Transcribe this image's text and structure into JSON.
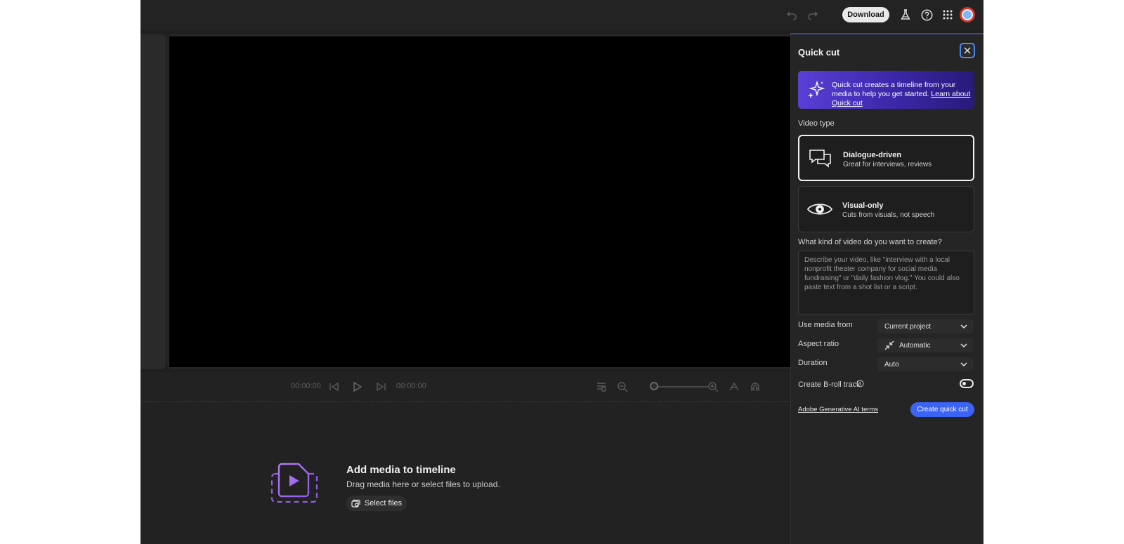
{
  "topbar": {
    "download_label": "Download",
    "icons": [
      "undo-icon",
      "redo-icon",
      "beaker-icon",
      "help-icon",
      "apps-grid-icon"
    ]
  },
  "transport": {
    "current_time": "00:00:00",
    "total_time": "00:00:00"
  },
  "timeline": {
    "title": "Add media to timeline",
    "subtitle": "Drag media here or select files to upload.",
    "select_files_label": "Select files"
  },
  "quick_cut": {
    "title": "Quick cut",
    "banner_text": "Quick cut creates a timeline from your media to help you get started.",
    "banner_link": "Learn about Quick cut",
    "video_type_label": "Video type",
    "video_types": [
      {
        "title": "Dialogue-driven",
        "desc": "Great for interviews, reviews",
        "selected": true
      },
      {
        "title": "Visual-only",
        "desc": "Cuts from visuals, not speech",
        "selected": false
      }
    ],
    "prompt_label": "What kind of video do you want to create?",
    "prompt_placeholder": "Describe your video, like \"interview with a local nonprofit theater company for social media fundraising\" or \"daily fashion vlog.\" You could also paste text from a shot list or a script.",
    "use_media_label": "Use media from",
    "use_media_value": "Current project",
    "aspect_label": "Aspect ratio",
    "aspect_value": "Automatic",
    "duration_label": "Duration",
    "duration_value": "Auto",
    "broll_label": "Create B-roll track",
    "broll_enabled": false,
    "terms_label": "Adobe Generative AI terms",
    "create_label": "Create quick cut"
  },
  "colors": {
    "accent_blue": "#3b63f5",
    "banner_purple": "#5a3fd6",
    "media_icon_purple": "#a26bf0"
  }
}
